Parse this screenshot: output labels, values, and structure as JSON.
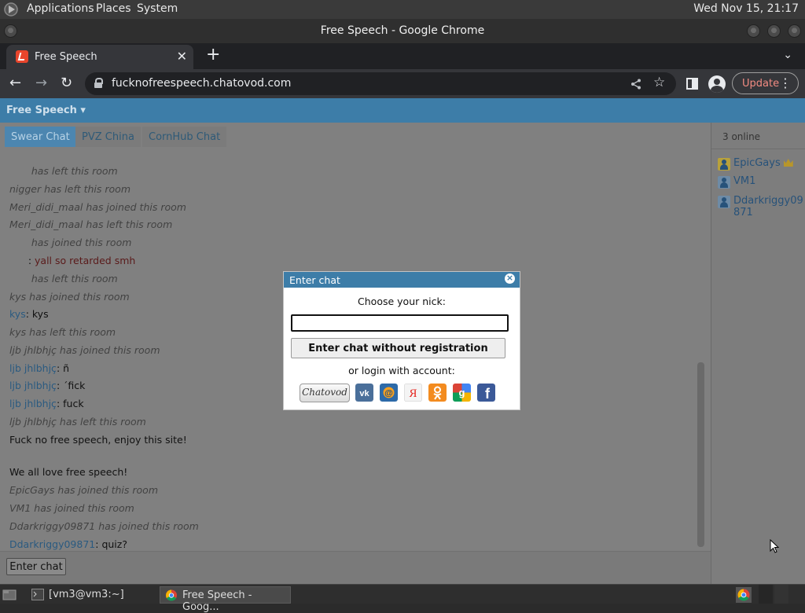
{
  "system_panel": {
    "menus": [
      "Applications",
      "Places",
      "System"
    ],
    "clock": "Wed Nov 15, 21:17"
  },
  "window": {
    "title": "Free Speech - Google Chrome"
  },
  "browser": {
    "tab_title": "Free Speech",
    "url": "fucknofreespeech.chatovod.com",
    "update_label": "Update"
  },
  "site": {
    "brand": "Free Speech ▾",
    "rooms": [
      "Swear Chat",
      "PVZ China",
      "CornHub Chat"
    ],
    "active_room": "Swear Chat",
    "messages": [
      {
        "nick": "",
        "text": "has left this room",
        "system": true,
        "nick_hidden": true
      },
      {
        "nick": "nigger",
        "text": "has left this room",
        "system": true
      },
      {
        "nick": "Meri_didi_maal",
        "text": "has joined this room",
        "system": true
      },
      {
        "nick": "Meri_didi_maal",
        "text": "has left this room",
        "system": true
      },
      {
        "nick": "",
        "text": "has joined this room",
        "system": true,
        "nick_hidden": true
      },
      {
        "nick": "",
        "text": "yall so retarded smh",
        "system": false,
        "nick_hidden": true,
        "text_color": "#5a1a1a"
      },
      {
        "nick": "",
        "text": "has left this room",
        "system": true,
        "nick_hidden": true
      },
      {
        "nick": "kys",
        "text": "has joined this room",
        "system": true
      },
      {
        "nick": "kys",
        "text": "kys",
        "system": false
      },
      {
        "nick": "kys",
        "text": "has left this room",
        "system": true
      },
      {
        "nick": "ljb jhlbhjç",
        "text": "has joined this room",
        "system": true
      },
      {
        "nick": "ljb jhlbhjç",
        "text": "ñ",
        "system": false
      },
      {
        "nick": "ljb jhlbhjç",
        "text": "´fick",
        "system": false
      },
      {
        "nick": "ljb jhlbhjç",
        "text": "fuck",
        "system": false
      },
      {
        "nick": "ljb jhlbhjç",
        "text": "has left this room",
        "system": true
      },
      {
        "nick": "",
        "text": "Fuck no free speech, enjoy this site!",
        "system": false,
        "plain": true
      },
      {
        "nick": "",
        "text": "We all love free speech!",
        "system": false,
        "plain": true
      },
      {
        "nick": "EpicGays",
        "text": "has joined this room",
        "system": true
      },
      {
        "nick": "VM1",
        "text": "has joined this room",
        "system": true
      },
      {
        "nick": "Ddarkriggy09871",
        "text": "has joined this room",
        "system": true
      },
      {
        "nick": "Ddarkriggy09871",
        "text": "quiz?",
        "system": false
      }
    ],
    "enter_chat_label": "Enter chat",
    "online_count": "3 online",
    "users": [
      {
        "name": "EpicGays",
        "admin": true
      },
      {
        "name": "VM1",
        "admin": false
      },
      {
        "name": "Ddarkriggy09871",
        "admin": false
      }
    ]
  },
  "dialog": {
    "title": "Enter chat",
    "nick_label": "Choose your nick:",
    "nick_value": "",
    "enter_button": "Enter chat without registration",
    "login_label": "or login with account:",
    "providers": [
      "Chatovod",
      "VK",
      "Mail.ru",
      "Yandex",
      "Odnoklassniki",
      "Google",
      "Facebook"
    ]
  },
  "taskbar": {
    "tasks": [
      "[vm3@vm3:~]",
      "Free Speech - Goog..."
    ]
  }
}
